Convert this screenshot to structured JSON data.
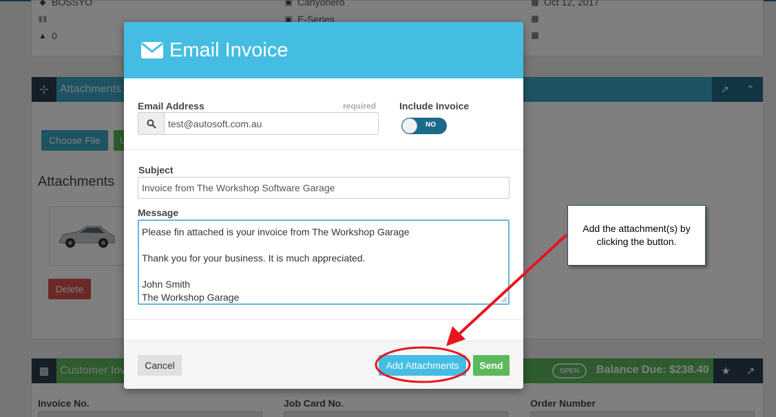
{
  "background": {
    "vehicle_info": {
      "rego": "BOSSYO",
      "make": "Canyonero",
      "date": "Oct 12, 2017",
      "series": "E-Series",
      "odometer": "0"
    },
    "attachments_panel": {
      "title": "Attachments",
      "choose_file_label": "Choose File",
      "upload_label": "U",
      "heading": "Attachments",
      "delete_label": "Delete"
    },
    "customer_invoice_panel": {
      "title": "Customer Inv",
      "status": "OPEN",
      "balance": "Balance Due: $238.40",
      "fields": [
        "Invoice No.",
        "Job Card No.",
        "Order Number"
      ]
    }
  },
  "modal": {
    "title": "Email Invoice",
    "email_label": "Email Address",
    "email_required": "required",
    "email_value": "test@autosoft.com.au",
    "include_invoice_label": "Include Invoice",
    "include_invoice_state": "NO",
    "subject_label": "Subject",
    "subject_value": "Invoice from The Workshop Software Garage",
    "message_label": "Message",
    "message_lines": [
      "Please fin attached is your invoice from The Workshop Garage",
      "",
      "Thank you for your business. It is much appreciated.",
      "",
      "John Smith",
      "The Workshop Garage"
    ],
    "cancel_label": "Cancel",
    "add_attachments_label": "Add Attachments",
    "send_label": "Send"
  },
  "annotation": {
    "callout_line1": "Add the attachment(s) by",
    "callout_line2": "clicking the button.",
    "arrow_color": "#e8141c",
    "highlight_color": "#e8141c"
  },
  "colors": {
    "header_blue": "#45bde3",
    "toggle_dark": "#1c6a8b",
    "send_green": "#5cb85c"
  }
}
